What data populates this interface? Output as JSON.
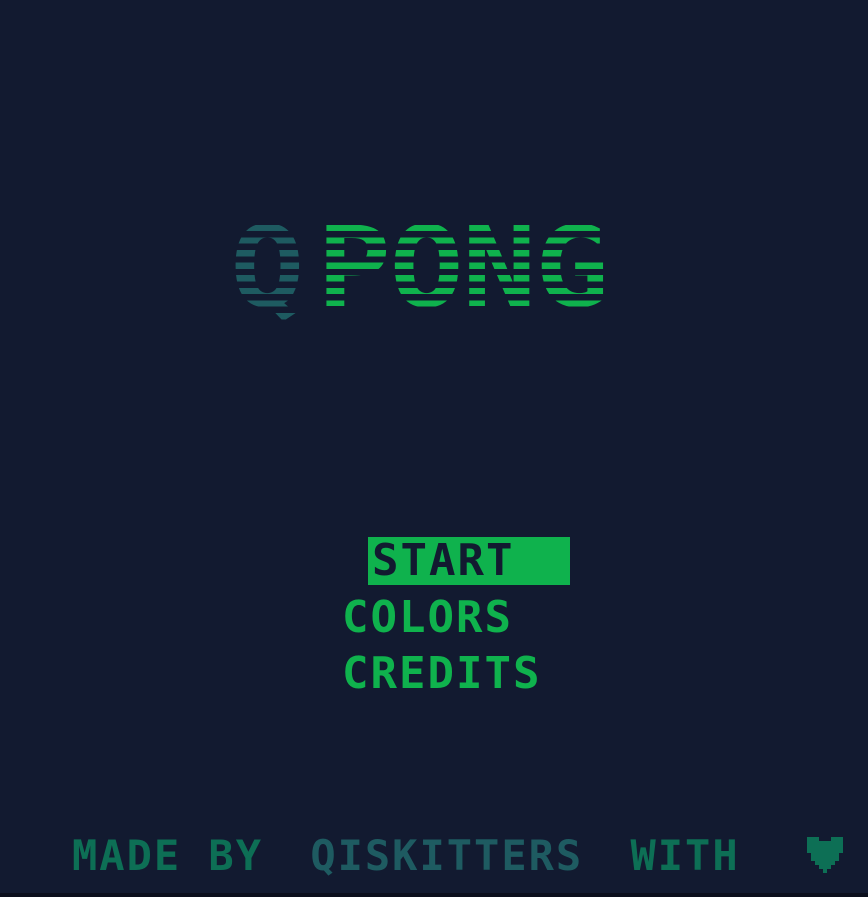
{
  "title": {
    "q": "Q",
    "pong": "PONG"
  },
  "menu": {
    "items": [
      {
        "label": "START",
        "selected": true
      },
      {
        "label": "COLORS",
        "selected": false
      },
      {
        "label": "CREDITS",
        "selected": false
      }
    ]
  },
  "footer": {
    "made_by": "MADE BY",
    "team": "QISKITTERS",
    "with": "WITH",
    "icon": "heart-icon"
  },
  "colors": {
    "background": "#121a30",
    "primary": "#0fb24d",
    "secondary": "#1e5b61",
    "footer": "#0d6f55"
  }
}
